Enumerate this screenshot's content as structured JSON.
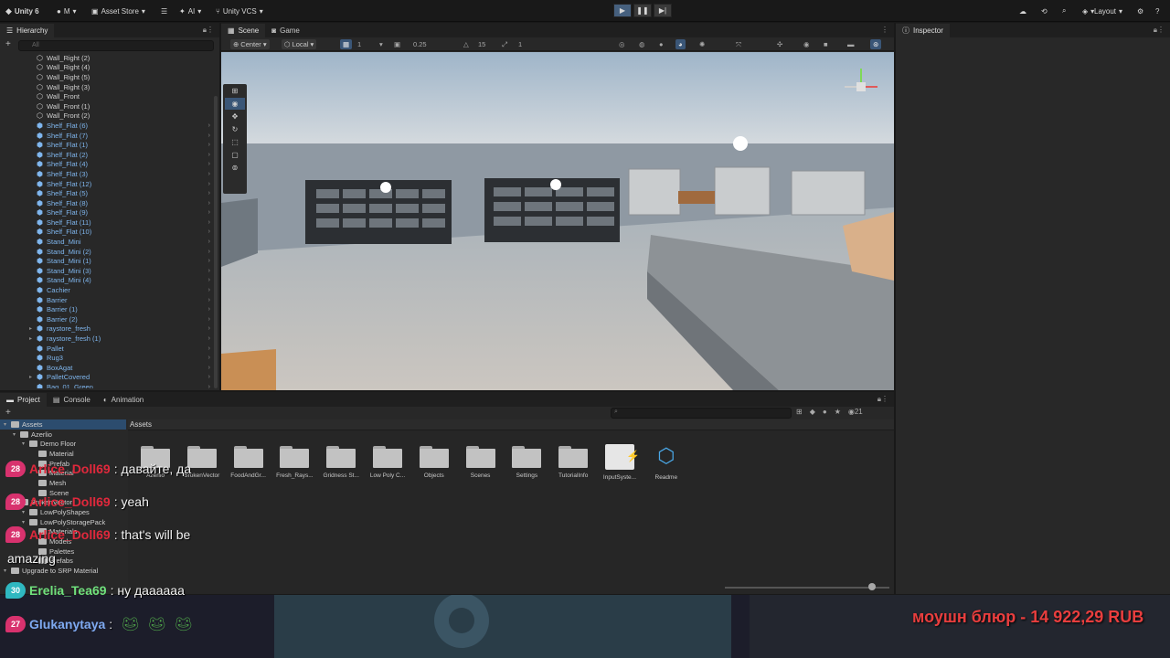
{
  "topbar": {
    "unity_label": "Unity 6",
    "account_label": "M",
    "asset_store_label": "Asset Store",
    "ai_label": "AI",
    "vcs_label": "Unity VCS",
    "layout_label": "Layout"
  },
  "hierarchy": {
    "tab_label": "Hierarchy",
    "search_placeholder": "All",
    "items": [
      {
        "label": "Wall_Right (2)",
        "type": "plain",
        "expandable": false
      },
      {
        "label": "Wall_Right (4)",
        "type": "plain",
        "expandable": false
      },
      {
        "label": "Wall_Right (5)",
        "type": "plain",
        "expandable": false
      },
      {
        "label": "Wall_Right (3)",
        "type": "plain",
        "expandable": false
      },
      {
        "label": "Wall_Front",
        "type": "plain",
        "expandable": false
      },
      {
        "label": "Wall_Front (1)",
        "type": "plain",
        "expandable": false
      },
      {
        "label": "Wall_Front (2)",
        "type": "plain",
        "expandable": false
      },
      {
        "label": "Shelf_Flat (6)",
        "type": "prefab",
        "expandable": true
      },
      {
        "label": "Shelf_Flat (7)",
        "type": "prefab",
        "expandable": true
      },
      {
        "label": "Shelf_Flat (1)",
        "type": "prefab",
        "expandable": true
      },
      {
        "label": "Shelf_Flat (2)",
        "type": "prefab",
        "expandable": true
      },
      {
        "label": "Shelf_Flat (4)",
        "type": "prefab",
        "expandable": true
      },
      {
        "label": "Shelf_Flat (3)",
        "type": "prefab",
        "expandable": true
      },
      {
        "label": "Shelf_Flat (12)",
        "type": "prefab",
        "expandable": true
      },
      {
        "label": "Shelf_Flat (5)",
        "type": "prefab",
        "expandable": true
      },
      {
        "label": "Shelf_Flat (8)",
        "type": "prefab",
        "expandable": true
      },
      {
        "label": "Shelf_Flat (9)",
        "type": "prefab",
        "expandable": true
      },
      {
        "label": "Shelf_Flat (11)",
        "type": "prefab",
        "expandable": true
      },
      {
        "label": "Shelf_Flat (10)",
        "type": "prefab",
        "expandable": true
      },
      {
        "label": "Stand_Mini",
        "type": "prefab",
        "expandable": true
      },
      {
        "label": "Stand_Mini (2)",
        "type": "prefab",
        "expandable": true
      },
      {
        "label": "Stand_Mini (1)",
        "type": "prefab",
        "expandable": true
      },
      {
        "label": "Stand_Mini (3)",
        "type": "prefab",
        "expandable": true
      },
      {
        "label": "Stand_Mini (4)",
        "type": "prefab",
        "expandable": true
      },
      {
        "label": "Cachier",
        "type": "prefab",
        "expandable": true
      },
      {
        "label": "Barrier",
        "type": "prefab",
        "expandable": true
      },
      {
        "label": "Barrier (1)",
        "type": "prefab",
        "expandable": true
      },
      {
        "label": "Barrier (2)",
        "type": "prefab",
        "expandable": true
      },
      {
        "label": "raystore_fresh",
        "type": "prefab",
        "expandable": true,
        "folded": true
      },
      {
        "label": "raystore_fresh (1)",
        "type": "prefab",
        "expandable": true,
        "folded": true
      },
      {
        "label": "Pallet",
        "type": "prefab",
        "expandable": true
      },
      {
        "label": "Rug3",
        "type": "prefab",
        "expandable": true
      },
      {
        "label": "BoxAgat",
        "type": "prefab",
        "expandable": true
      },
      {
        "label": "PalletCovered",
        "type": "prefab",
        "expandable": true,
        "folded": true
      },
      {
        "label": "Bag_01_Green",
        "type": "prefab",
        "expandable": true
      }
    ]
  },
  "scene": {
    "tab_scene": "Scene",
    "tab_game": "Game",
    "pivot_label": "Center",
    "space_label": "Local",
    "grid_value": "1",
    "snap_value": "0.25",
    "angle_value": "15",
    "scale_value": "1"
  },
  "inspector": {
    "tab_label": "Inspector"
  },
  "project": {
    "tab_project": "Project",
    "tab_console": "Console",
    "tab_animation": "Animation",
    "breadcrumb": "Assets",
    "hidden_count": "21",
    "tree": [
      {
        "label": "Assets",
        "depth": 0
      },
      {
        "label": "Azerlio",
        "depth": 1
      },
      {
        "label": "Demo Floor",
        "depth": 2
      },
      {
        "label": "Material",
        "depth": 3
      },
      {
        "label": "Prefab",
        "depth": 3
      },
      {
        "label": "Material",
        "depth": 3
      },
      {
        "label": "Mesh",
        "depth": 3
      },
      {
        "label": "Scene",
        "depth": 3
      },
      {
        "label": "BrokenVector",
        "depth": 1
      },
      {
        "label": "LowPolyShapes",
        "depth": 2
      },
      {
        "label": "LowPolyStoragePack",
        "depth": 2
      },
      {
        "label": "Materials",
        "depth": 3
      },
      {
        "label": "Models",
        "depth": 3
      },
      {
        "label": "Palettes",
        "depth": 3
      },
      {
        "label": "Prefabs",
        "depth": 3
      },
      {
        "label": "Upgrade to SRP Material",
        "depth": 0
      }
    ],
    "assets": [
      {
        "label": "Azerlio",
        "kind": "folder"
      },
      {
        "label": "BrokenVector",
        "kind": "folder"
      },
      {
        "label": "FoodAndGr...",
        "kind": "folder"
      },
      {
        "label": "Fresh_Rays...",
        "kind": "folder"
      },
      {
        "label": "Gridness St...",
        "kind": "folder"
      },
      {
        "label": "Low Poly C...",
        "kind": "folder"
      },
      {
        "label": "Objects",
        "kind": "folder"
      },
      {
        "label": "Scenes",
        "kind": "folder"
      },
      {
        "label": "Settings",
        "kind": "folder"
      },
      {
        "label": "TutorialInfo",
        "kind": "folder"
      },
      {
        "label": "InputSyste...",
        "kind": "input-actions"
      },
      {
        "label": "Readme",
        "kind": "readme"
      }
    ]
  },
  "chat": [
    {
      "badge": "28",
      "user": "Arlice_Doll69",
      "message": ": давайте, да",
      "badge_color": "#d8326e",
      "user_color": "#e0283c"
    },
    {
      "badge": "28",
      "user": "Arlice_Doll69",
      "message": ": yeah",
      "badge_color": "#d8326e",
      "user_color": "#e0283c"
    },
    {
      "badge": "28",
      "user": "Arlice_Doll69",
      "message": ": that's will be",
      "badge_color": "#d8326e",
      "user_color": "#e0283c"
    },
    {
      "badge": "",
      "user": "",
      "message": "amazing",
      "badge_color": "",
      "user_color": ""
    },
    {
      "badge": "30",
      "user": "Erelia_Tea69",
      "message": ": ну даааааа",
      "badge_color": "#2fb8c0",
      "user_color": "#6fe07c"
    },
    {
      "badge": "27",
      "user": "Glukanytaya",
      "message": ":",
      "badge_color": "#d8326e",
      "user_color": "#7ea9f0"
    }
  ],
  "donation": {
    "text": "моушн блюр - 14 922,29 RUB",
    "color": "#e93e3e"
  }
}
